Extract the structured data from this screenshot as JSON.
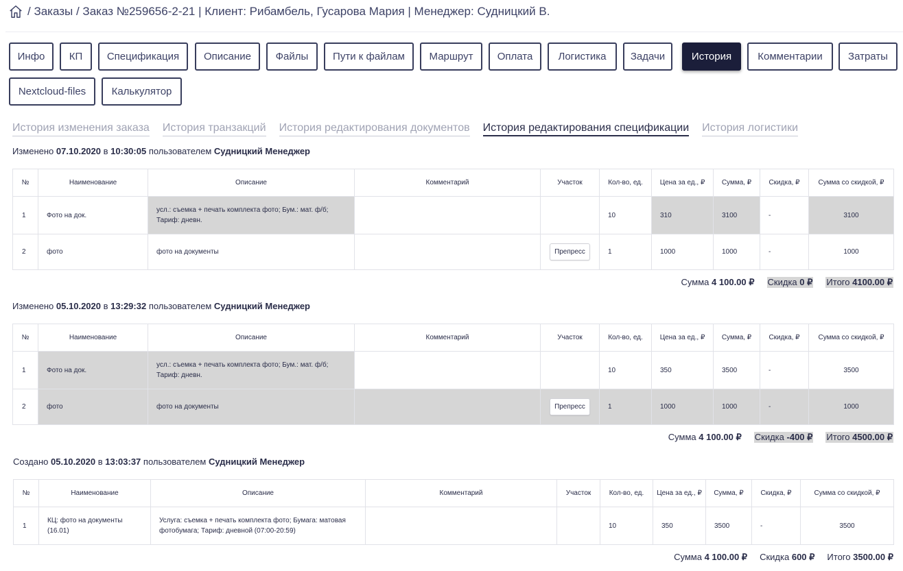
{
  "breadcrumb": {
    "home_icon": "home-icon",
    "text": "/ Заказы / Заказ №259656-2-21 | Клиент: Рибамбель, Гусарова Мария | Менеджер: Судницкий В."
  },
  "tabs": [
    {
      "label": "Инфо",
      "active": false
    },
    {
      "label": "КП",
      "active": false
    },
    {
      "label": "Спецификация",
      "active": false
    },
    {
      "label": "Описание",
      "active": false
    },
    {
      "label": "Файлы",
      "active": false
    },
    {
      "label": "Пути к файлам",
      "active": false
    },
    {
      "label": "Маршрут",
      "active": false
    },
    {
      "label": "Оплата",
      "active": false
    },
    {
      "label": "Логистика",
      "active": false
    },
    {
      "label": "Задачи",
      "active": false
    },
    {
      "label": "История",
      "active": true
    },
    {
      "label": "Комментарии",
      "active": false
    },
    {
      "label": "Затраты",
      "active": false
    },
    {
      "label": "Nextcloud-files",
      "active": false
    },
    {
      "label": "Калькулятор",
      "active": false
    }
  ],
  "subtabs": [
    {
      "label": "История изменения заказа",
      "active": false
    },
    {
      "label": "История транзакций",
      "active": false
    },
    {
      "label": "История редактирования документов",
      "active": false
    },
    {
      "label": "История редактирования спецификации",
      "active": true
    },
    {
      "label": "История логистики",
      "active": false
    }
  ],
  "columns": [
    "№",
    "Наименование",
    "Описание",
    "Комментарий",
    "Участок",
    "Кол-во, ед.",
    "Цена за ед., ₽",
    "Сумма, ₽",
    "Скидка, ₽",
    "Сумма со скидкой, ₽"
  ],
  "entries": [
    {
      "action": "Изменено",
      "date": "07.10.2020",
      "at": "в",
      "time": "10:30:05",
      "by": "пользователем",
      "user": "Судницкий Менеджер",
      "rows": [
        {
          "num": "1",
          "name": "Фото на док.",
          "description": "усл.: съемка + печать комплекта фото; Бум.: мат. ф/б; Тариф: дневн.",
          "comment": "",
          "section": "",
          "qty": "10",
          "price": "310",
          "sum": "3100",
          "discount": "-",
          "total": "3100"
        },
        {
          "num": "2",
          "name": "фото",
          "description": "фото на документы",
          "comment": "",
          "section": "Препресс",
          "qty": "1",
          "price": "1000",
          "sum": "1000",
          "discount": "-",
          "total": "1000"
        }
      ],
      "totals": {
        "sum_label": "Сумма",
        "sum": "4 100.00 ₽",
        "discount_label": "Скидка",
        "discount": "0 ₽",
        "total_label": "Итого",
        "total": "4100.00 ₽"
      }
    },
    {
      "action": "Изменено",
      "date": "05.10.2020",
      "at": "в",
      "time": "13:29:32",
      "by": "пользователем",
      "user": "Судницкий Менеджер",
      "rows": [
        {
          "num": "1",
          "name": "Фото на док.",
          "description": "усл.: съемка + печать комплекта фото; Бум.: мат. ф/б; Тариф: дневн.",
          "comment": "",
          "section": "",
          "qty": "10",
          "price": "350",
          "sum": "3500",
          "discount": "-",
          "total": "3500"
        },
        {
          "num": "2",
          "name": "фото",
          "description": "фото на документы",
          "comment": "",
          "section": "Препресс",
          "qty": "1",
          "price": "1000",
          "sum": "1000",
          "discount": "-",
          "total": "1000"
        }
      ],
      "totals": {
        "sum_label": "Сумма",
        "sum": "4 100.00 ₽",
        "discount_label": "Скидка",
        "discount": "-400 ₽",
        "total_label": "Итого",
        "total": "4500.00 ₽"
      }
    },
    {
      "action": "Создано",
      "date": "05.10.2020",
      "at": "в",
      "time": "13:03:37",
      "by": "пользователем",
      "user": "Судницкий Менеджер",
      "rows": [
        {
          "num": "1",
          "name": "КЦ: фото на документы (16.01)",
          "description": "Услуга: съемка + печать комплекта фото; Бумага: матовая фотобумага; Тариф: дневной (07:00-20:59)",
          "comment": "",
          "section": "",
          "qty": "10",
          "price": "350",
          "sum": "3500",
          "discount": "-",
          "total": "3500"
        }
      ],
      "totals": {
        "sum_label": "Сумма",
        "sum": "4 100.00 ₽",
        "discount_label": "Скидка",
        "discount": "600 ₽",
        "total_label": "Итого",
        "total": "3500.00 ₽"
      }
    }
  ],
  "colors": {
    "text": "#2c2f4a",
    "active_tab_bg": "#1b1e3a",
    "highlight": "#d6d6d6",
    "border": "#e1e2e8"
  }
}
